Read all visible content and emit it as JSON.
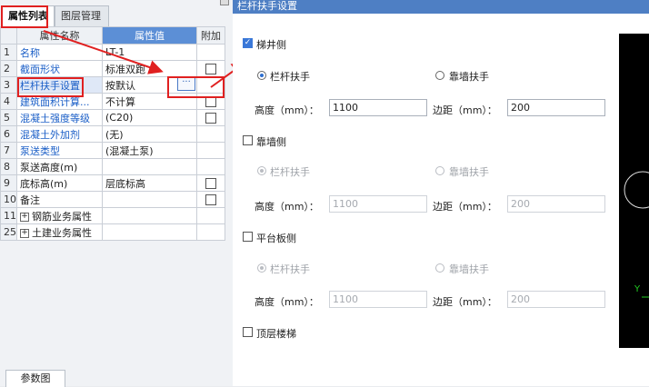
{
  "left": {
    "tabs": [
      "属性列表",
      "图层管理"
    ],
    "headers": [
      "属性名称",
      "属性值",
      "附加"
    ],
    "rows": [
      {
        "num": "1",
        "name": "名称",
        "value": "LT-1",
        "blue": true
      },
      {
        "num": "2",
        "name": "截面形状",
        "value": "标准双跑",
        "blue": true
      },
      {
        "num": "3",
        "name": "栏杆扶手设置",
        "value": "按默认",
        "blue": true
      },
      {
        "num": "4",
        "name": "建筑面积计算...",
        "value": "不计算",
        "blue": true
      },
      {
        "num": "5",
        "name": "混凝土强度等级",
        "value": "(C20)",
        "blue": true
      },
      {
        "num": "6",
        "name": "混凝土外加剂",
        "value": "(无)",
        "blue": true
      },
      {
        "num": "7",
        "name": "泵送类型",
        "value": "(混凝土泵)",
        "blue": true
      },
      {
        "num": "8",
        "name": "泵送高度(m)",
        "value": "",
        "blue": false
      },
      {
        "num": "9",
        "name": "底标高(m)",
        "value": "层底标高",
        "blue": false
      },
      {
        "num": "10",
        "name": "备注",
        "value": "",
        "blue": false
      },
      {
        "num": "11",
        "name": "钢筋业务属性",
        "value": "",
        "blue": false
      },
      {
        "num": "25",
        "name": "土建业务属性",
        "value": "",
        "blue": false
      }
    ],
    "ellipsis": "···",
    "bottom_tab": "参数图"
  },
  "dialog": {
    "title": "栏杆扶手设置",
    "stairwell": {
      "label": "梯井侧",
      "checked": true,
      "opt1": "栏杆扶手",
      "opt2": "靠墙扶手",
      "height_label": "高度（mm）：",
      "height": "1100",
      "margin_label": "边距（mm）：",
      "margin": "200"
    },
    "wall": {
      "label": "靠墙侧",
      "checked": false,
      "opt1": "栏杆扶手",
      "opt2": "靠墙扶手",
      "height_label": "高度（mm）：",
      "height": "1100",
      "margin_label": "边距（mm）：",
      "margin": "200"
    },
    "platform": {
      "label": "平台板侧",
      "checked": false,
      "opt1": "栏杆扶手",
      "opt2": "靠墙扶手",
      "height_label": "高度（mm）：",
      "height": "1100",
      "margin_label": "边距（mm）：",
      "margin": "200"
    },
    "top_floor": {
      "label": "顶层楼梯",
      "checked": false
    },
    "axis_label": "Y",
    "colors": {
      "title_bar": "#4e7fc4",
      "annotation": "#e02020",
      "axis": "#22cc22"
    }
  }
}
